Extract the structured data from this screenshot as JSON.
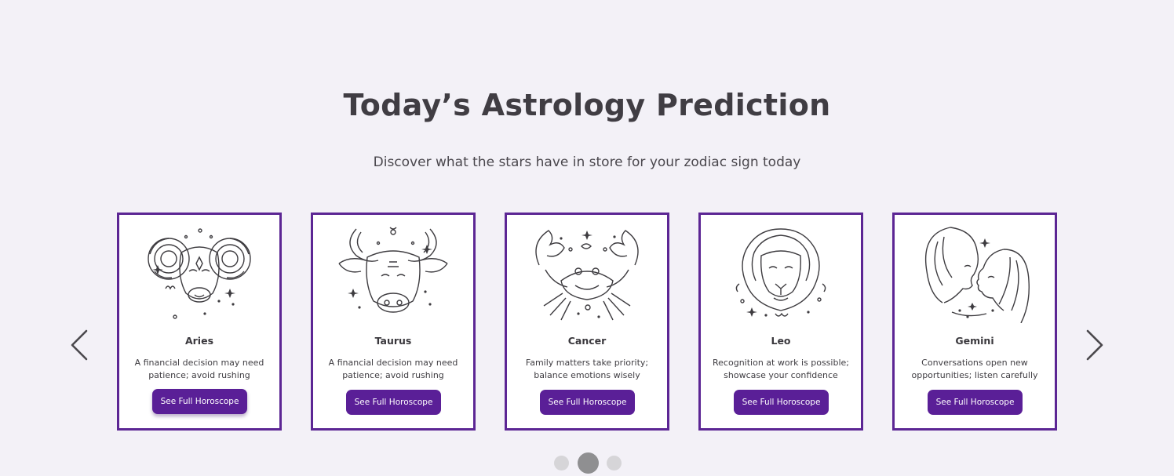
{
  "header": {
    "title": "Today’s Astrology Prediction",
    "subtitle": "Discover what the stars have in store for your zodiac sign today"
  },
  "carousel": {
    "prev_icon": "chevron-left-icon",
    "next_icon": "chevron-right-icon",
    "cards": [
      {
        "name": "Aries",
        "description": "A financial decision may need patience; avoid rushing",
        "button_label": "See Full Horoscope",
        "icon": "aries-ram-illustration"
      },
      {
        "name": "Taurus",
        "description": "A financial decision may need patience; avoid rushing",
        "button_label": "See Full Horoscope",
        "icon": "taurus-bull-illustration"
      },
      {
        "name": "Cancer",
        "description": "Family matters take priority; balance emotions wisely",
        "button_label": "See Full Horoscope",
        "icon": "cancer-crab-illustration"
      },
      {
        "name": "Leo",
        "description": "Recognition at work is possible; showcase your confidence",
        "button_label": "See Full Horoscope",
        "icon": "leo-lion-illustration"
      },
      {
        "name": "Gemini",
        "description": "Conversations open new opportunities; listen carefully",
        "button_label": "See Full Horoscope",
        "icon": "gemini-twins-illustration"
      }
    ],
    "pagination": {
      "total": 3,
      "active": 2
    }
  },
  "colors": {
    "background": "#f3f1f7",
    "card_border": "#5c2694",
    "button": "#5a1f97",
    "dot_active": "#8f8f91",
    "dot_inactive": "#d6d5d8"
  }
}
